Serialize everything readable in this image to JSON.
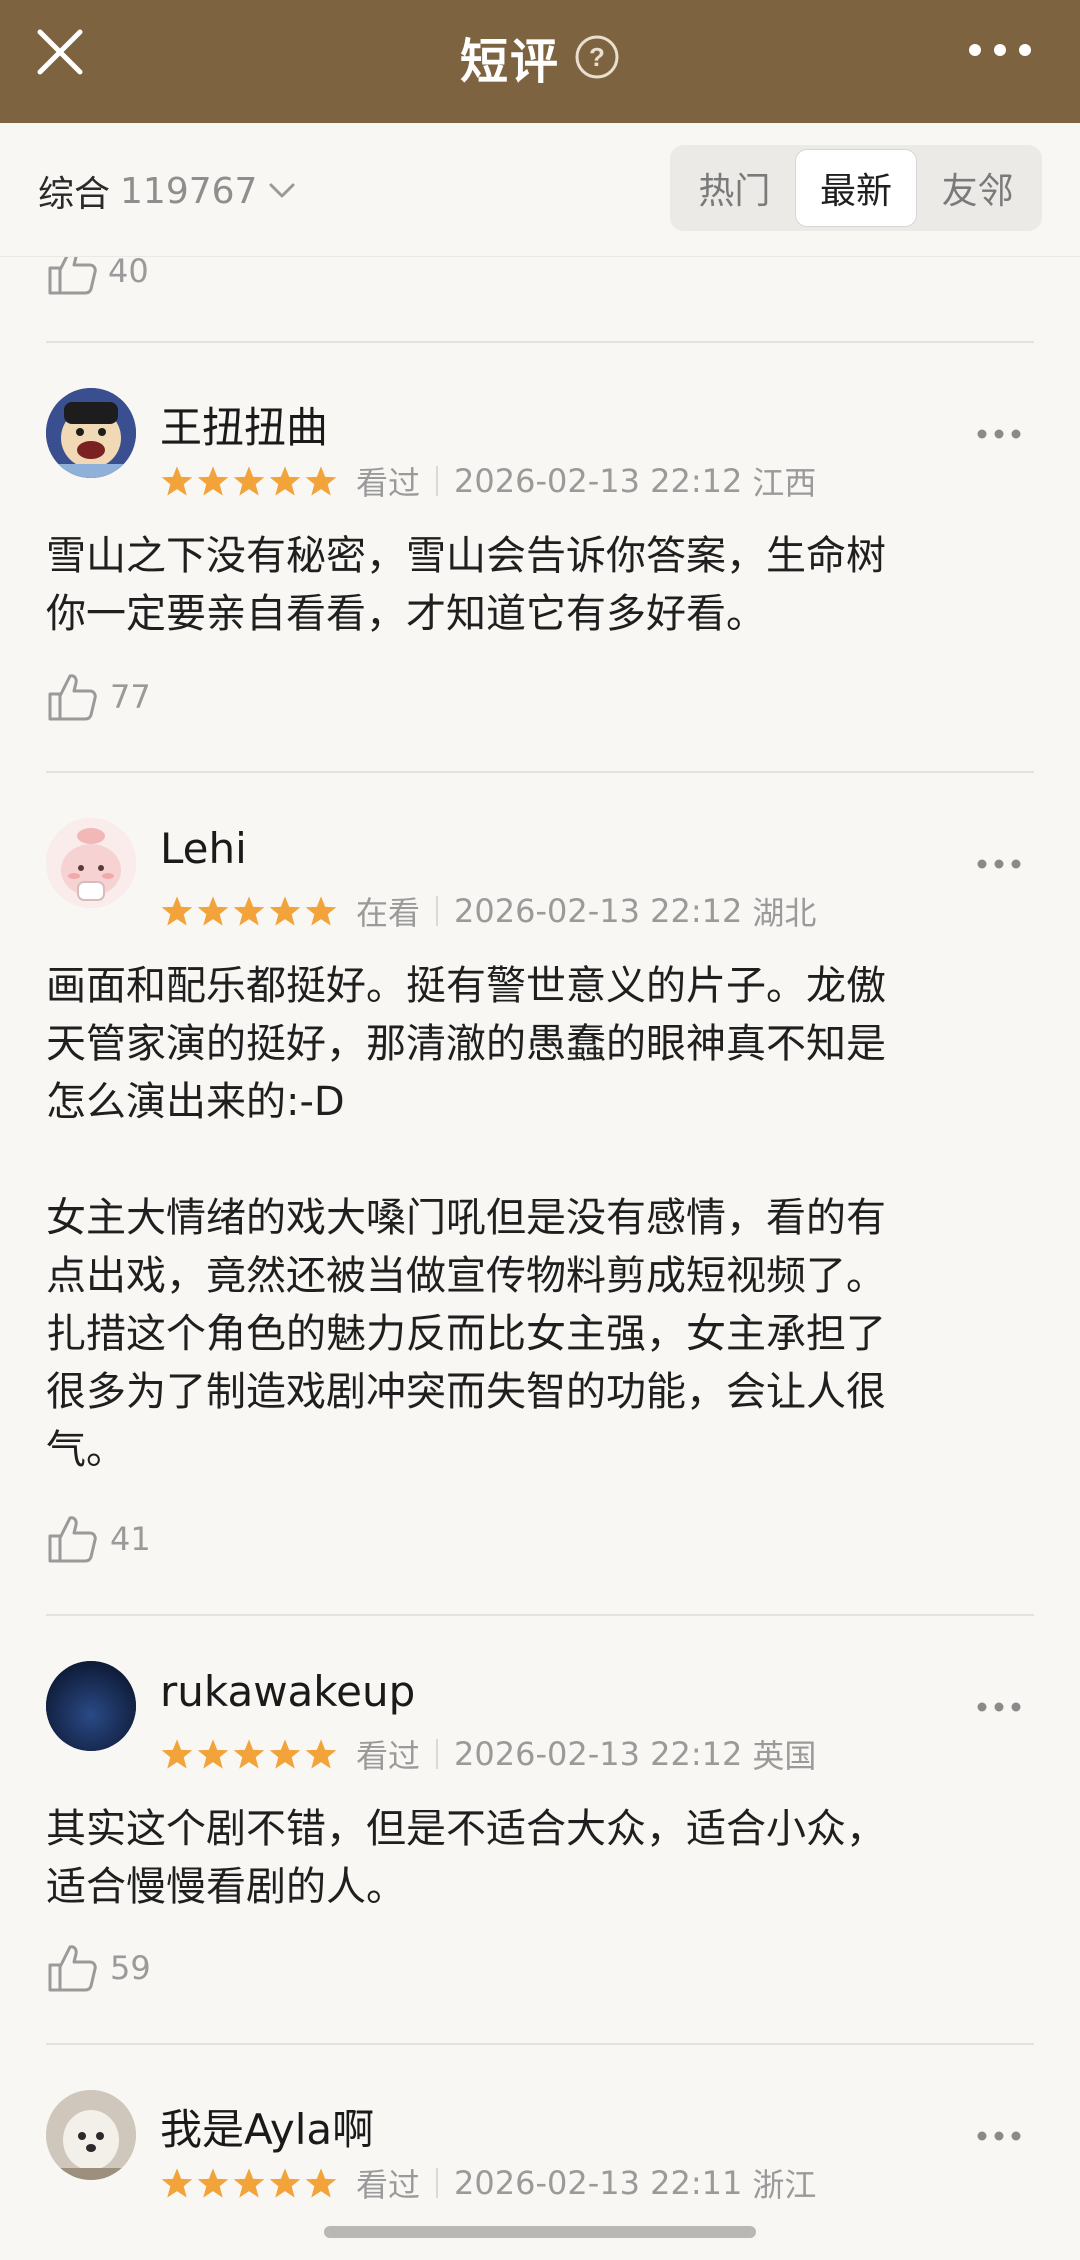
{
  "header": {
    "title": "短评",
    "help_symbol": "?",
    "bg_color": "#7e6340"
  },
  "filter": {
    "sort_label": "综合",
    "sort_count": "119767",
    "tabs": [
      {
        "label": "热门",
        "active": false
      },
      {
        "label": "最新",
        "active": true
      },
      {
        "label": "友邻",
        "active": false
      }
    ]
  },
  "previous_review_likes": "40",
  "reviews": [
    {
      "user": "王扭扭曲",
      "rating": 5,
      "status": "看过",
      "datetime": "2026-02-13 22:12",
      "location": "江西",
      "text": "雪山之下没有秘密，雪山会告诉你答案，生命树\n你一定要亲自看看，才知道它有多好看。",
      "likes": "77"
    },
    {
      "user": "Lehi",
      "rating": 5,
      "status": "在看",
      "datetime": "2026-02-13 22:12",
      "location": "湖北",
      "text": "画面和配乐都挺好。挺有警世意义的片子。龙傲\n天管家演的挺好，那清澈的愚蠢的眼神真不知是\n怎么演出来的:-D\n\n女主大情绪的戏大嗓门吼但是没有感情，看的有\n点出戏，竟然还被当做宣传物料剪成短视频了。\n扎措这个角色的魅力反而比女主强，女主承担了\n很多为了制造戏剧冲突而失智的功能，会让人很\n气。",
      "likes": "41"
    },
    {
      "user": "rukawakeup",
      "rating": 5,
      "status": "看过",
      "datetime": "2026-02-13 22:12",
      "location": "英国",
      "text": "其实这个剧不错，但是不适合大众，适合小众，\n适合慢慢看剧的人。",
      "likes": "59"
    },
    {
      "user": "我是Ayla啊",
      "rating": 5,
      "status": "看过",
      "datetime": "2026-02-13 22:11",
      "location": "浙江",
      "text": "",
      "likes": ""
    }
  ],
  "colors": {
    "star": "#f2a33a",
    "meta_text": "#9a9a9a",
    "divider": "#e4e2dd"
  },
  "icons": [
    "close-icon",
    "help-icon",
    "more-icon",
    "chevron-down-icon",
    "star-icon",
    "thumbs-up-icon"
  ]
}
